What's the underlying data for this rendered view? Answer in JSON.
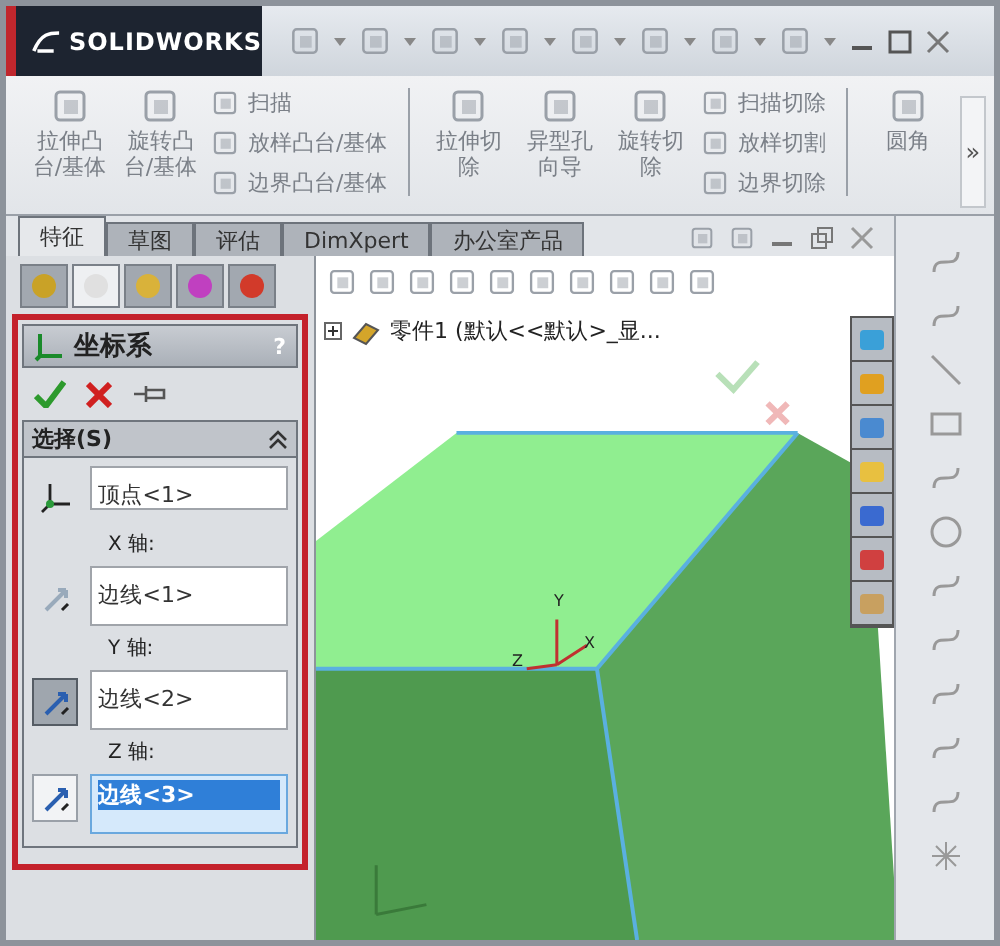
{
  "app": {
    "logo": "SOLIDWORKS"
  },
  "ribbon": {
    "groups": [
      {
        "kind": "big",
        "lines": [
          "拉伸凸",
          "台/基体"
        ]
      },
      {
        "kind": "big",
        "lines": [
          "旋转凸",
          "台/基体"
        ]
      },
      {
        "kind": "small",
        "items": [
          "扫描",
          "放样凸台/基体",
          "边界凸台/基体"
        ]
      },
      {
        "kind": "sep"
      },
      {
        "kind": "big",
        "lines": [
          "拉伸切",
          "除"
        ]
      },
      {
        "kind": "big",
        "lines": [
          "异型孔",
          "向导"
        ]
      },
      {
        "kind": "big",
        "lines": [
          "旋转切",
          "除"
        ]
      },
      {
        "kind": "small",
        "items": [
          "扫描切除",
          "放样切割",
          "边界切除"
        ]
      },
      {
        "kind": "sep"
      },
      {
        "kind": "big",
        "lines": [
          "圆角"
        ]
      }
    ],
    "more": "»"
  },
  "tabs": [
    {
      "label": "特征",
      "selected": true
    },
    {
      "label": "草图",
      "selected": false
    },
    {
      "label": "评估",
      "selected": false
    },
    {
      "label": "DimXpert",
      "selected": false
    },
    {
      "label": "办公室产品",
      "selected": false
    }
  ],
  "panel_tabs": [
    {
      "selected": false
    },
    {
      "selected": true
    },
    {
      "selected": false
    },
    {
      "selected": false
    },
    {
      "selected": false
    }
  ],
  "property_manager": {
    "title": "坐标系",
    "help": "?",
    "section": "选择(S)",
    "fields": [
      {
        "kind": "origin",
        "value": "顶点<1>"
      },
      {
        "kind": "axis",
        "label": "X 轴:",
        "value": "边线<1>",
        "pressed": false,
        "focused": false
      },
      {
        "kind": "axis",
        "label": "Y 轴:",
        "value": "边线<2>",
        "pressed": true,
        "focused": false
      },
      {
        "kind": "axis",
        "label": "Z 轴:",
        "value": "边线<3>",
        "pressed": false,
        "focused": true
      }
    ]
  },
  "viewport": {
    "tree_item": "零件1  (默认<<默认>_显...",
    "triad": [
      "Y",
      "Z",
      "X"
    ]
  }
}
